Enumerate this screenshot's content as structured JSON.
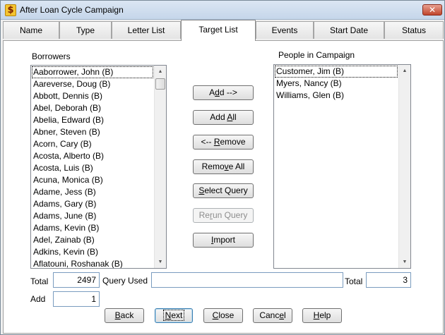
{
  "window": {
    "title": "After Loan Cycle Campaign",
    "close_glyph": "✕",
    "app_glyph": "$"
  },
  "tabs": [
    {
      "label": "Name",
      "active": false
    },
    {
      "label": "Type",
      "active": false
    },
    {
      "label": "Letter List",
      "active": false
    },
    {
      "label": "Target List",
      "active": true
    },
    {
      "label": "Events",
      "active": false
    },
    {
      "label": "Start Date",
      "active": false
    },
    {
      "label": "Status",
      "active": false
    }
  ],
  "borrowers": {
    "label": "Borrowers",
    "items": [
      "Aaborrower, John (B)",
      "Aareverse, Doug (B)",
      "Abbott, Dennis (B)",
      "Abel, Deborah (B)",
      "Abelia, Edward (B)",
      "Abner, Steven (B)",
      "Acorn, Cary (B)",
      "Acosta, Alberto (B)",
      "Acosta, Luis (B)",
      "Acuna, Monica (B)",
      "Adame, Jess (B)",
      "Adams, Gary (B)",
      "Adams, June (B)",
      "Adams, Kevin (B)",
      "Adel, Zainab (B)",
      "Adkins, Kevin (B)",
      "Aflatouni, Roshanak (B)"
    ],
    "focused_index": 0
  },
  "campaign": {
    "label": "People in Campaign",
    "items": [
      "Customer, Jim (B)",
      "Myers, Nancy (B)",
      "Williams, Glen (B)"
    ],
    "focused_index": 0
  },
  "actions": {
    "add": {
      "pre": "A",
      "ul": "d",
      "post": "d -->"
    },
    "add_all": {
      "pre": "Add ",
      "ul": "A",
      "post": "ll"
    },
    "remove": {
      "pre": "<-- ",
      "ul": "R",
      "post": "emove"
    },
    "remove_all": {
      "pre": "Remo",
      "ul": "v",
      "post": "e All"
    },
    "select_query": {
      "pre": "",
      "ul": "S",
      "post": "elect Query"
    },
    "rerun_query": {
      "pre": "Re",
      "ul": "r",
      "post": "un Query"
    },
    "import": {
      "pre": "",
      "ul": "I",
      "post": "mport"
    }
  },
  "footer": {
    "total_label": "Total",
    "total_value": "2497",
    "query_label": "Query Used",
    "query_value": "",
    "campaign_total_label": "Total",
    "campaign_total_value": "3",
    "add_label": "Add",
    "add_value": "1"
  },
  "nav": {
    "back": {
      "pre": "",
      "ul": "B",
      "post": "ack"
    },
    "next": {
      "pre": "",
      "ul": "N",
      "post": "ext"
    },
    "close": {
      "pre": "",
      "ul": "C",
      "post": "lose"
    },
    "cancel": {
      "pre": "Canc",
      "ul": "e",
      "post": "l"
    },
    "help": {
      "pre": "",
      "ul": "H",
      "post": "elp"
    }
  },
  "scrollbar": {
    "up_glyph": "▲",
    "down_glyph": "▼"
  }
}
